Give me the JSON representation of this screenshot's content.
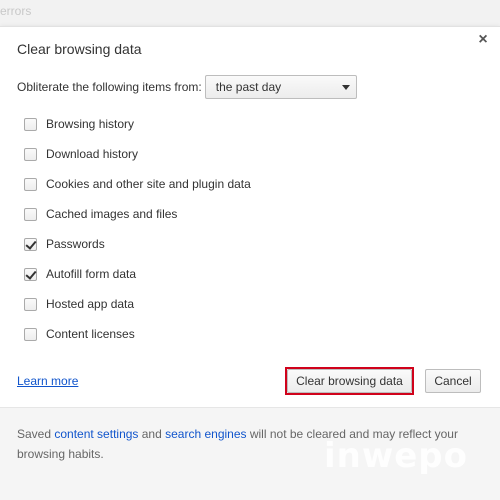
{
  "background": {
    "partial_text": "errors"
  },
  "dialog": {
    "title": "Clear browsing data",
    "close_glyph": "×",
    "obliterate_label": "Obliterate the following items from:",
    "time_range": {
      "selected": "the past day"
    },
    "items": [
      {
        "label": "Browsing history",
        "checked": false
      },
      {
        "label": "Download history",
        "checked": false
      },
      {
        "label": "Cookies and other site and plugin data",
        "checked": false
      },
      {
        "label": "Cached images and files",
        "checked": false
      },
      {
        "label": "Passwords",
        "checked": true
      },
      {
        "label": "Autofill form data",
        "checked": true
      },
      {
        "label": "Hosted app data",
        "checked": false
      },
      {
        "label": "Content licenses",
        "checked": false
      }
    ],
    "learn_more": "Learn more",
    "clear_button": "Clear browsing data",
    "cancel_button": "Cancel",
    "highlight_color": "#d0021b",
    "footer": {
      "prefix": "Saved ",
      "link1": "content settings",
      "middle": " and ",
      "link2": "search engines",
      "suffix": " will not be cleared and may reflect your browsing habits."
    }
  },
  "watermark": "inwepo"
}
